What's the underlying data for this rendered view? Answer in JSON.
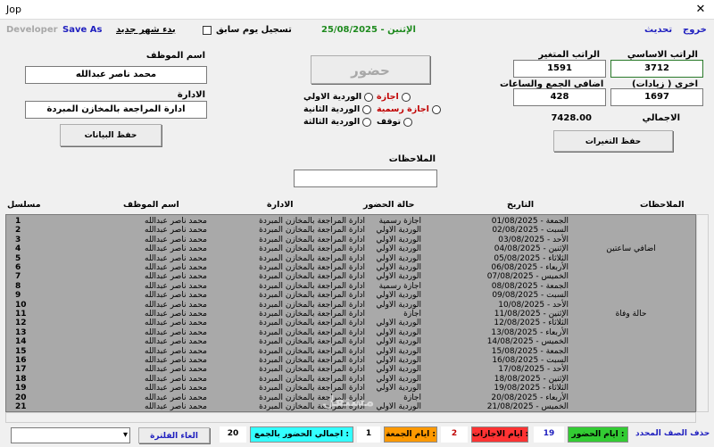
{
  "window": {
    "title": "Jop",
    "close_glyph": "✕"
  },
  "toolbar": {
    "exit": "خروج",
    "refresh": "تحديث",
    "developer": "Developer",
    "save_as": "Save As",
    "new_month": "بدء شهر جديد",
    "prev_day": "تسجيل يوم سابق",
    "date_text": "25/08/2025 - الإثنين"
  },
  "salary": {
    "basic_label": "الراتب الاساسي",
    "basic_value": "3712",
    "variable_label": "الراتب المتغير",
    "variable_value": "1591",
    "other_label": "اخري ( زيادات)",
    "other_value": "1697",
    "extra_label": "اضافي الجمع والساعات",
    "extra_value": "428",
    "total_label": "الاجمالي",
    "total_value": "7428.00",
    "save_changes": "حفظ التغيرات"
  },
  "attendance": {
    "present_button": "حضور",
    "radios": {
      "first_shift": "الوردية الاولي",
      "second_shift": "الوردية الثانية",
      "third_shift": "الوردية الثالثة",
      "leave": "اجازة",
      "official_leave": "اجازة رسمية",
      "stop": "توقف"
    },
    "notes_label": "الملاحظات",
    "notes_value": ""
  },
  "employee": {
    "name_label": "اسم الموظف",
    "name_value": "محمد ناصر عبدالله",
    "dept_label": "الادارة",
    "dept_value": "ادارة المراجعة بالمخازن المبردة",
    "save_data": "حفظ البيانات"
  },
  "table": {
    "headers": {
      "notes": "الملاحظات",
      "date": "التاريخ",
      "status": "حالة الحضور",
      "dept": "الادارة",
      "name": "اسم الموظف",
      "serial": "مسلسل"
    },
    "rows": [
      {
        "no": "1",
        "name": "محمد ناصر عبدالله",
        "dept": "ادارة المراجعة بالمخازن المبردة",
        "status": "اجازة رسمية",
        "date": "01/08/2025 - الجمعة",
        "note": ""
      },
      {
        "no": "2",
        "name": "محمد ناصر عبدالله",
        "dept": "ادارة المراجعة بالمخازن المبردة",
        "status": "الوردية الاولي",
        "date": "02/08/2025 - السبت",
        "note": ""
      },
      {
        "no": "3",
        "name": "محمد ناصر عبدالله",
        "dept": "ادارة المراجعة بالمخازن المبردة",
        "status": "الوردية الاولي",
        "date": "03/08/2025 - الأحد",
        "note": ""
      },
      {
        "no": "4",
        "name": "محمد ناصر عبدالله",
        "dept": "ادارة المراجعة بالمخازن المبردة",
        "status": "الوردية الاولي",
        "date": "04/08/2025 - الإثنين",
        "note": "اضافي ساعتين"
      },
      {
        "no": "5",
        "name": "محمد ناصر عبدالله",
        "dept": "ادارة المراجعة بالمخازن المبردة",
        "status": "الوردية الاولي",
        "date": "05/08/2025 - الثلاثاء",
        "note": ""
      },
      {
        "no": "6",
        "name": "محمد ناصر عبدالله",
        "dept": "ادارة المراجعة بالمخازن المبردة",
        "status": "الوردية الاولي",
        "date": "06/08/2025 - الأربعاء",
        "note": ""
      },
      {
        "no": "7",
        "name": "محمد ناصر عبدالله",
        "dept": "ادارة المراجعة بالمخازن المبردة",
        "status": "الوردية الاولي",
        "date": "07/08/2025 - الخميس",
        "note": ""
      },
      {
        "no": "8",
        "name": "محمد ناصر عبدالله",
        "dept": "ادارة المراجعة بالمخازن المبردة",
        "status": "اجازة رسمية",
        "date": "08/08/2025 - الجمعة",
        "note": ""
      },
      {
        "no": "9",
        "name": "محمد ناصر عبدالله",
        "dept": "ادارة المراجعة بالمخازن المبردة",
        "status": "الوردية الاولي",
        "date": "09/08/2025 - السبت",
        "note": ""
      },
      {
        "no": "10",
        "name": "محمد ناصر عبدالله",
        "dept": "ادارة المراجعة بالمخازن المبردة",
        "status": "الوردية الاولي",
        "date": "10/08/2025 - الأحد",
        "note": ""
      },
      {
        "no": "11",
        "name": "محمد ناصر عبدالله",
        "dept": "ادارة المراجعة بالمخازن المبردة",
        "status": "اجازة",
        "date": "11/08/2025 - الإثنين",
        "note": "حالة وفاة"
      },
      {
        "no": "12",
        "name": "محمد ناصر عبدالله",
        "dept": "ادارة المراجعة بالمخازن المبردة",
        "status": "الوردية الاولي",
        "date": "12/08/2025 - الثلاثاء",
        "note": ""
      },
      {
        "no": "13",
        "name": "محمد ناصر عبدالله",
        "dept": "ادارة المراجعة بالمخازن المبردة",
        "status": "الوردية الاولي",
        "date": "13/08/2025 - الأربعاء",
        "note": ""
      },
      {
        "no": "14",
        "name": "محمد ناصر عبدالله",
        "dept": "ادارة المراجعة بالمخازن المبردة",
        "status": "الوردية الاولي",
        "date": "14/08/2025 - الخميس",
        "note": ""
      },
      {
        "no": "15",
        "name": "محمد ناصر عبدالله",
        "dept": "ادارة المراجعة بالمخازن المبردة",
        "status": "الوردية الاولي",
        "date": "15/08/2025 - الجمعة",
        "note": ""
      },
      {
        "no": "16",
        "name": "محمد ناصر عبدالله",
        "dept": "ادارة المراجعة بالمخازن المبردة",
        "status": "الوردية الاولي",
        "date": "16/08/2025 - السبت",
        "note": ""
      },
      {
        "no": "17",
        "name": "محمد ناصر عبدالله",
        "dept": "ادارة المراجعة بالمخازن المبردة",
        "status": "الوردية الاولي",
        "date": "17/08/2025 - الأحد",
        "note": ""
      },
      {
        "no": "18",
        "name": "محمد ناصر عبدالله",
        "dept": "ادارة المراجعة بالمخازن المبردة",
        "status": "الوردية الاولي",
        "date": "18/08/2025 - الإثنين",
        "note": ""
      },
      {
        "no": "19",
        "name": "محمد ناصر عبدالله",
        "dept": "ادارة المراجعة بالمخازن المبردة",
        "status": "الوردية الاولي",
        "date": "19/08/2025 - الثلاثاء",
        "note": ""
      },
      {
        "no": "20",
        "name": "محمد ناصر عبدالله",
        "dept": "ادارة المراجعة بالمخازن المبردة",
        "status": "اجازة",
        "date": "20/08/2025 - الأربعاء",
        "note": ""
      },
      {
        "no": "21",
        "name": "محمد ناصر عبدالله",
        "dept": "ادارة المراجعة بالمخازن المبردة",
        "status": "الوردية الاولي",
        "date": "21/08/2025 - الخميس",
        "note": ""
      }
    ]
  },
  "footer": {
    "delete_row": "حذف الصف المحدد",
    "attendance_days_label": "ايام الحضور :",
    "attendance_days_value": "19",
    "leave_days_label": "ايام الاجازات :",
    "leave_days_value": "2",
    "friday_days_label": "ايام الجمعة :",
    "friday_days_value": "1",
    "total_attendance_label": "اجمالي الحضور بالجمع :",
    "total_attendance_value": "20",
    "cancel_filter": "الغاء الفلترة",
    "filter_value": "",
    "dropdown_glyph": "▾",
    "colors": {
      "attendance": "#33cc33",
      "leave": "#ff3333",
      "friday": "#ff9900",
      "total": "#33ffff"
    }
  },
  "watermark": "مستقل"
}
